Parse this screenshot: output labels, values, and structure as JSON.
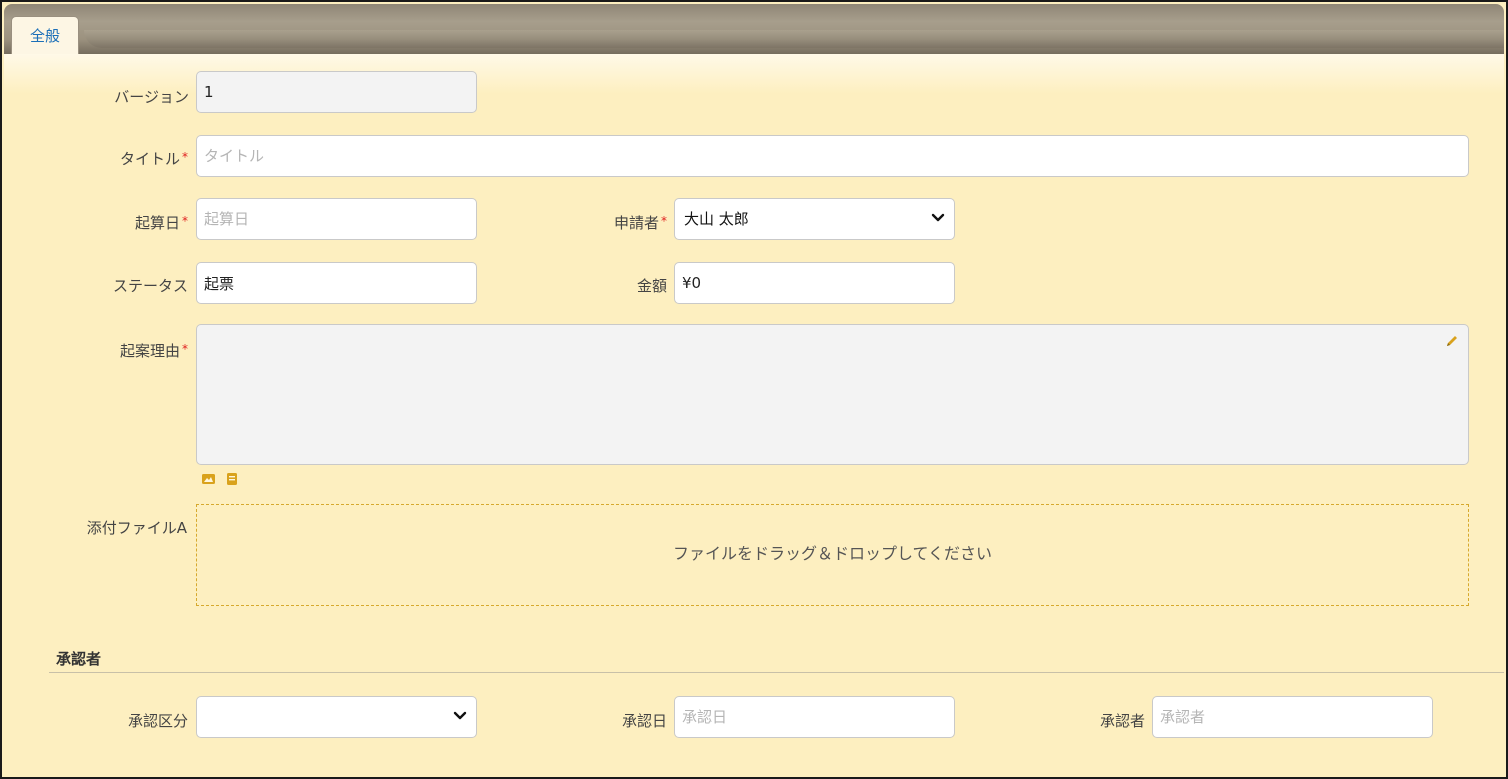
{
  "tabs": [
    {
      "label": "全般"
    }
  ],
  "required_mark": "*",
  "form": {
    "version": {
      "label": "バージョン",
      "value": "1"
    },
    "title": {
      "label": "タイトル",
      "placeholder": "タイトル",
      "value": ""
    },
    "start_date": {
      "label": "起算日",
      "placeholder": "起算日",
      "value": ""
    },
    "applicant": {
      "label": "申請者",
      "selected": "大山 太郎"
    },
    "status": {
      "label": "ステータス",
      "value": "起票"
    },
    "amount": {
      "label": "金額",
      "value": "¥0"
    },
    "reason": {
      "label": "起案理由",
      "value": ""
    },
    "attachment": {
      "label": "添付ファイルA",
      "dropzone_text": "ファイルをドラッグ＆ドロップしてください"
    }
  },
  "approvers": {
    "section_title": "承認者",
    "category": {
      "label": "承認区分",
      "selected": ""
    },
    "approval_date": {
      "label": "承認日",
      "placeholder": "承認日",
      "value": ""
    },
    "approver": {
      "label": "承認者",
      "placeholder": "承認者",
      "value": ""
    }
  },
  "icons": {
    "chevron": "chevron-down-icon",
    "edit": "pencil-icon",
    "image": "image-icon",
    "file": "file-icon"
  },
  "colors": {
    "background": "#fdefc0",
    "tab_text": "#1b6fb8",
    "required": "#e02020",
    "dropzone_border": "#d6a92e",
    "icon": "#d9a21c"
  }
}
